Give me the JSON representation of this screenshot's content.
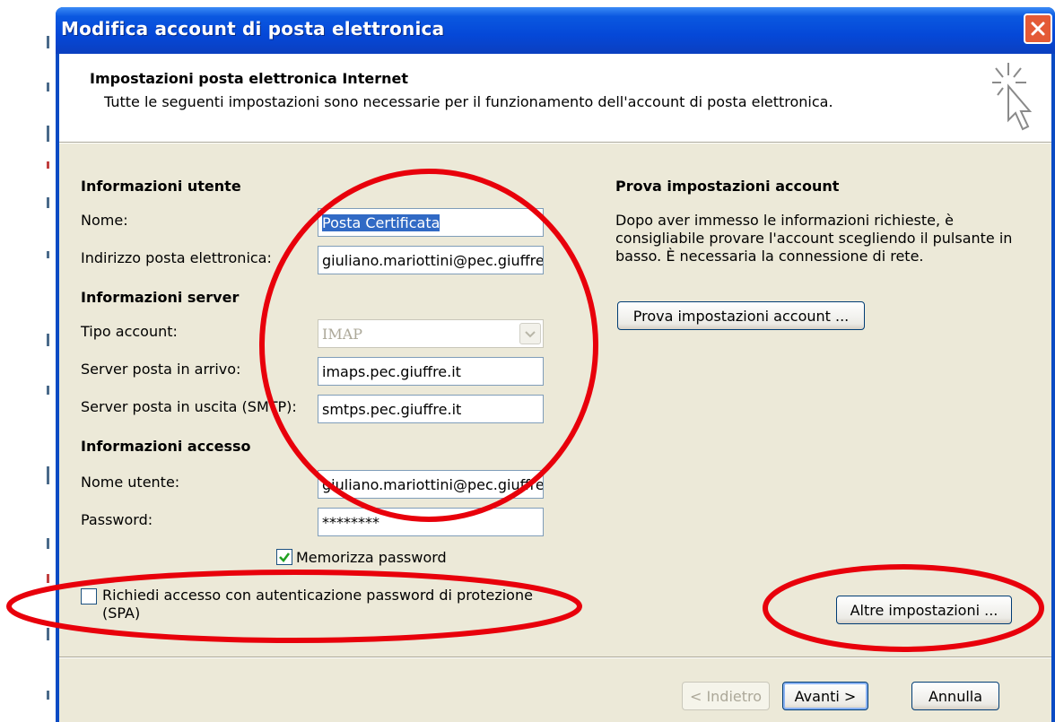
{
  "window": {
    "title": "Modifica account di posta elettronica",
    "close_icon": "close-icon"
  },
  "header": {
    "title": "Impostazioni posta elettronica Internet",
    "subtitle": "Tutte le seguenti impostazioni sono necessarie per il funzionamento dell'account di posta elettronica.",
    "icon": "wizard-sparkle-cursor-icon"
  },
  "user_info": {
    "heading": "Informazioni utente",
    "name_label": "Nome:",
    "name_value": "Posta Certificata",
    "email_label": "Indirizzo posta elettronica:",
    "email_value": "giuliano.mariottini@pec.giuffre"
  },
  "server_info": {
    "heading": "Informazioni server",
    "account_type_label": "Tipo account:",
    "account_type_value": "IMAP",
    "incoming_label": "Server posta in arrivo:",
    "incoming_value": "imaps.pec.giuffre.it",
    "outgoing_label": "Server posta in uscita (SMTP):",
    "outgoing_value": "smtps.pec.giuffre.it"
  },
  "access_info": {
    "heading": "Informazioni accesso",
    "username_label": "Nome utente:",
    "username_value": "giuliano.mariottini@pec.giuffre",
    "password_label": "Password:",
    "password_value": "********",
    "remember_label": "Memorizza password",
    "remember_checked": true,
    "spa_label_line1": "Richiedi accesso con autenticazione password di protezione",
    "spa_label_line2": "(SPA)",
    "spa_checked": false
  },
  "test": {
    "heading": "Prova impostazioni account",
    "description_line1": "Dopo aver immesso le informazioni richieste, è",
    "description_line2": "consigliabile provare l'account scegliendo il pulsante in",
    "description_line3": "basso. È necessaria la connessione di rete.",
    "test_button": "Prova impostazioni account ...",
    "more_button": "Altre impostazioni ..."
  },
  "footer": {
    "back": "< Indietro",
    "next": "Avanti >",
    "cancel": "Annulla"
  },
  "colors": {
    "titlebar": "#0548d8",
    "dialog_bg": "#ece9d8",
    "annotation": "#e8000b",
    "selection": "#316ac5"
  }
}
